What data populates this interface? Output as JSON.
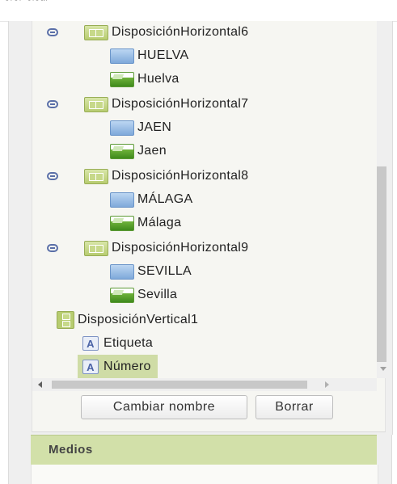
{
  "top_partial_text": "ᵊʳᵊʳ ᶜᶦᵉᵃʳ",
  "tree": {
    "groups": [
      {
        "name": "DisposiciónHorizontal6",
        "button": "HUELVA",
        "image": "Huelva"
      },
      {
        "name": "DisposiciónHorizontal7",
        "button": "JAEN",
        "image": "Jaen"
      },
      {
        "name": "DisposiciónHorizontal8",
        "button": "MÁLAGA",
        "image": "Málaga"
      },
      {
        "name": "DisposiciónHorizontal9",
        "button": "SEVILLA",
        "image": "Sevilla"
      }
    ],
    "vertical": "DisposiciónVertical1",
    "label1": "Etiqueta",
    "label2": "Número"
  },
  "actions": {
    "rename": "Cambiar nombre",
    "delete": "Borrar"
  },
  "section": {
    "title": "Medios"
  },
  "icons": {
    "toggle": "collapse-toggle-icon",
    "horizontal": "horizontal-arrangement-icon",
    "button": "button-icon",
    "image": "image-icon",
    "vertical": "vertical-arrangement-icon",
    "label": "label-icon"
  },
  "colors": {
    "selection": "#cfdca6",
    "section_header": "#d2e0a9",
    "toggle": "#5a6fa8"
  }
}
